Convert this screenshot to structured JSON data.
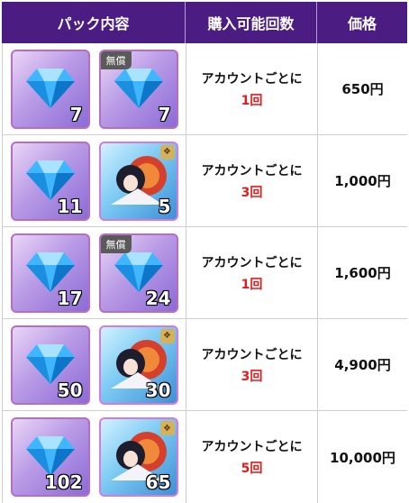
{
  "header": {
    "col_pack": "パック内容",
    "col_limit": "購入可能回数",
    "col_price": "価格"
  },
  "colors": {
    "header_bg": "#4b1d82",
    "limit_count": "#e31b1b"
  },
  "rows": [
    {
      "item1": {
        "count": "7",
        "icon": "diamond-icon"
      },
      "item2": {
        "count": "7",
        "icon": "diamond-icon",
        "badge": "無償"
      },
      "limit_prefix": "アカウントごとに",
      "limit_count": "1回",
      "price": "650円"
    },
    {
      "item1": {
        "count": "11",
        "icon": "diamond-icon"
      },
      "item2": {
        "count": "5",
        "icon": "character-icon"
      },
      "limit_prefix": "アカウントごとに",
      "limit_count": "3回",
      "price": "1,000円"
    },
    {
      "item1": {
        "count": "17",
        "icon": "diamond-icon"
      },
      "item2": {
        "count": "24",
        "icon": "diamond-icon",
        "badge": "無償"
      },
      "limit_prefix": "アカウントごとに",
      "limit_count": "1回",
      "price": "1,600円"
    },
    {
      "item1": {
        "count": "50",
        "icon": "diamond-icon"
      },
      "item2": {
        "count": "30",
        "icon": "character-icon"
      },
      "limit_prefix": "アカウントごとに",
      "limit_count": "3回",
      "price": "4,900円"
    },
    {
      "item1": {
        "count": "102",
        "icon": "diamond-icon"
      },
      "item2": {
        "count": "65",
        "icon": "character-icon"
      },
      "limit_prefix": "アカウントごとに",
      "limit_count": "5回",
      "price": "10,000円"
    }
  ]
}
